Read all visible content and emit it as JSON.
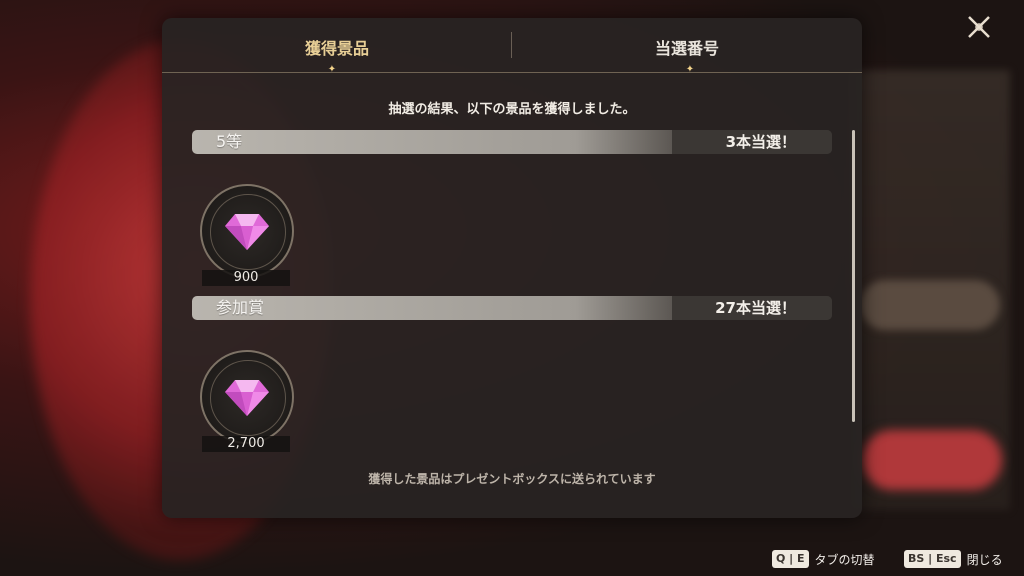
{
  "tabs": [
    {
      "label": "獲得景品",
      "active": true
    },
    {
      "label": "当選番号",
      "active": false
    }
  ],
  "intro_text": "抽選の結果、以下の景品を獲得しました。",
  "results": [
    {
      "label": "5等",
      "count_text": "3本当選！",
      "item_qty": "900"
    },
    {
      "label": "参加賞",
      "count_text": "27本当選！",
      "item_qty": "2,700"
    }
  ],
  "footer_note": "獲得した景品はプレゼントボックスに送られています",
  "hints": [
    {
      "keys": "Q | E",
      "label": "タブの切替"
    },
    {
      "keys": "BS | Esc",
      "label": "閉じる"
    }
  ],
  "colors": {
    "active_tab": "#e8cf96",
    "gem": "#e06ad8",
    "dialog_bg": "#282422"
  },
  "icons": {
    "close": "close-x-icon",
    "item": "pink-gem-icon"
  }
}
